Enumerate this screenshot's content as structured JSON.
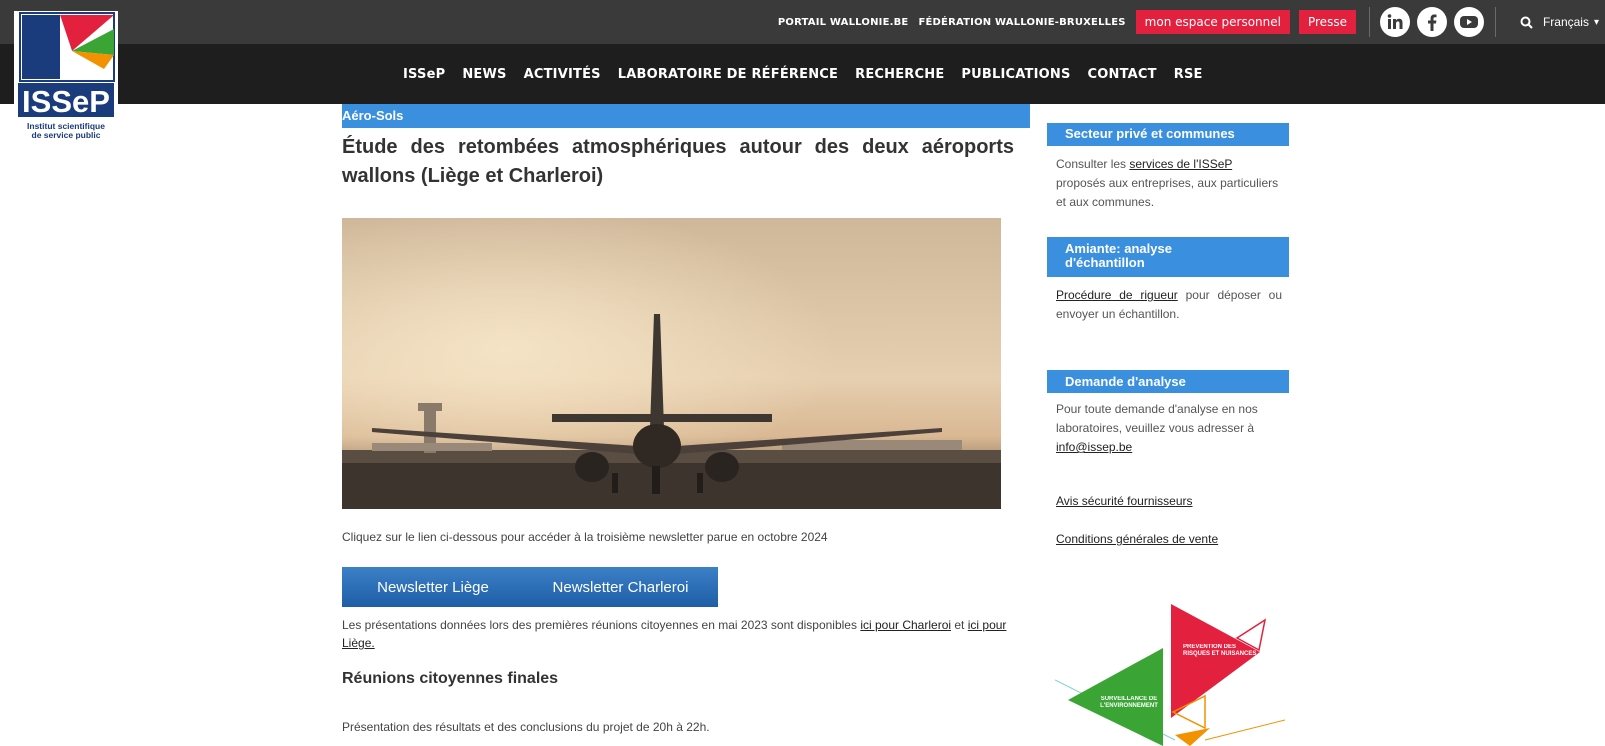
{
  "brand": {
    "logo_text": "ISSeP",
    "tagline_line1": "Institut scientifique",
    "tagline_line2": "de service public"
  },
  "top_links": {
    "portail": "PORTAIL WALLONIE.BE",
    "federation": "FÉDÉRATION WALLONIE-BRUXELLES",
    "espace": "mon espace personnel",
    "presse": "Presse",
    "language": "Français"
  },
  "social_icons": [
    "linkedin-icon",
    "facebook-icon",
    "youtube-icon"
  ],
  "nav": [
    "ISSeP",
    "NEWS",
    "ACTIVITÉS",
    "LABORATOIRE DE RÉFÉRENCE",
    "RECHERCHE",
    "PUBLICATIONS",
    "CONTACT",
    "RSE"
  ],
  "article": {
    "category": "Aéro-Sols",
    "title": "Étude des retombées atmosphériques autour des deux aéroports wallons (Liège et Charleroi)",
    "intro": "Cliquez sur le lien ci-dessous pour accéder à la troisième newsletter parue en octobre 2024",
    "btn_liege": "Newsletter Liège",
    "btn_charleroi": "Newsletter Charleroi",
    "pres_text": "Les présentations données lors des premières réunions citoyennes en mai 2023 sont disponibles",
    "pres_link1": "ici pour Charleroi",
    "pres_and": "et",
    "pres_link2": "ici pour Liège.",
    "h3": "Réunions citoyennes finales",
    "outro": "Présentation des résultats et des conclusions du projet de 20h à 22h."
  },
  "sidebar": {
    "box1": {
      "title": "Secteur privé et communes",
      "pre": "Consulter les",
      "link": "services de l'ISSeP",
      "post": "proposés aux entreprises, aux particuliers et aux communes."
    },
    "box2": {
      "title": "Amiante: analyse d'échantillon",
      "link": "Procédure de rigueur",
      "post": "pour déposer ou envoyer un échantillon."
    },
    "box3": {
      "title": "Demande d'analyse",
      "text": "Pour toute demande d'analyse en nos laboratoires, veuillez vous adresser à",
      "email": "info@issep.be"
    },
    "link_avis": "Avis sécurité fournisseurs",
    "link_conditions": "Conditions générales de vente",
    "graphic_label1": "PRÉVENTION DES RISQUES ET NUISANCES",
    "graphic_label2": "SURVEILLANCE DE L'ENVIRONNEMENT"
  },
  "colors": {
    "accent_blue": "#3a8fde",
    "accent_red": "#e4203f",
    "topbar": "#3a3a3a",
    "navbar": "#1e1e1e"
  }
}
